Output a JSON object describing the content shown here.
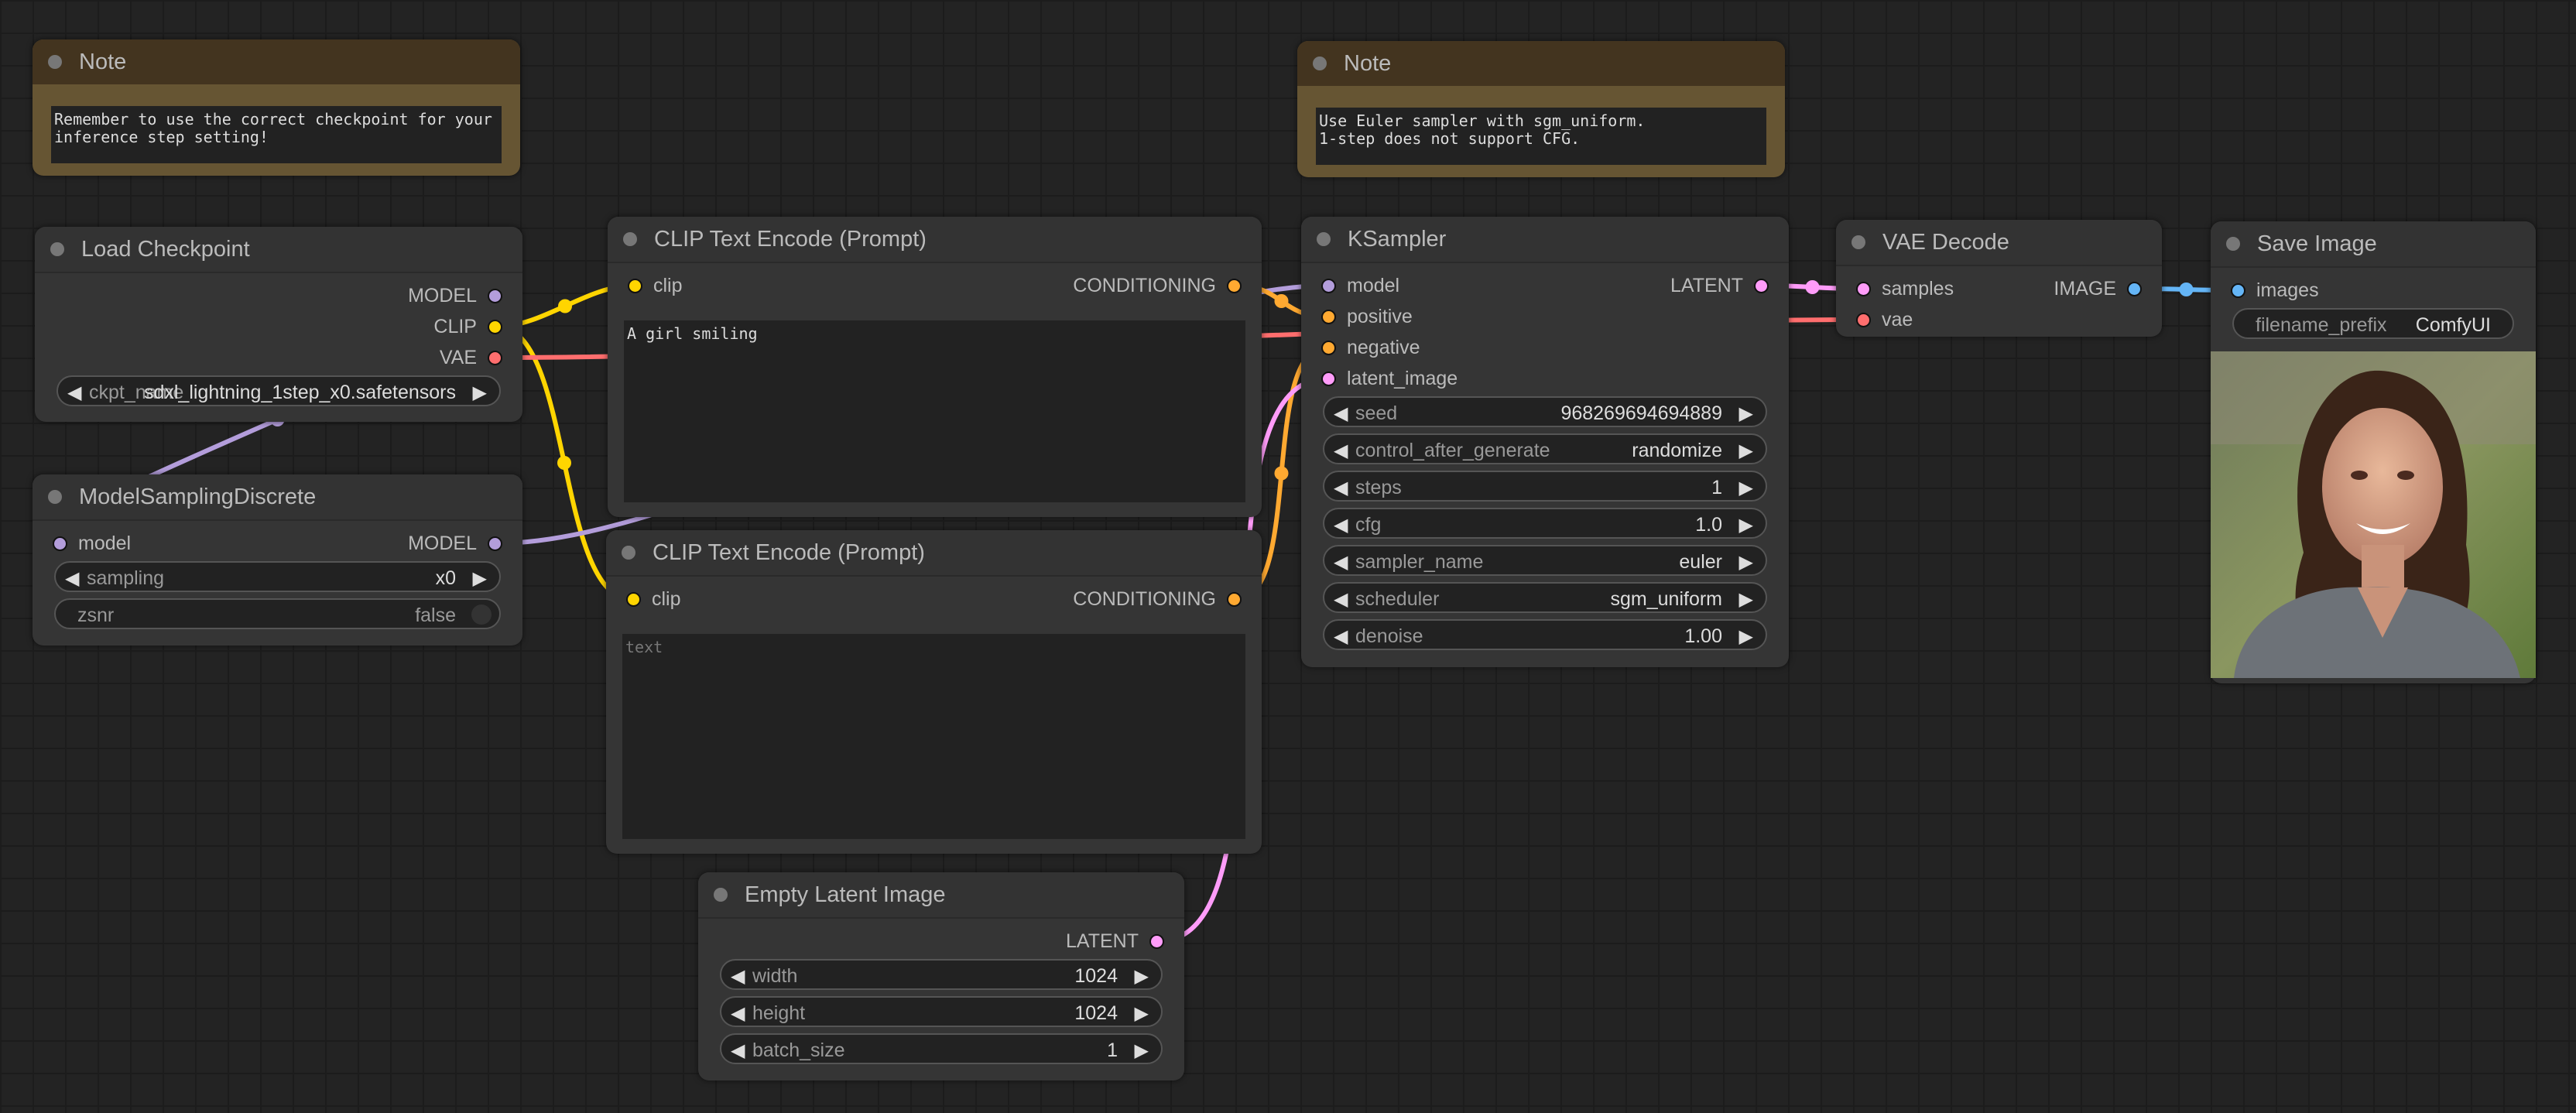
{
  "colors": {
    "MODEL": "#b39ddb",
    "CLIP": "#ffd500",
    "VAE": "#ff6e6e",
    "CONDITIONING": "#ffa931",
    "LATENT": "#ff9cf9",
    "IMAGE": "#64b5f6"
  },
  "nodes": {
    "note1": {
      "title": "Note",
      "text": "Remember to use the correct checkpoint for your\ninference step setting!"
    },
    "note2": {
      "title": "Note",
      "text": "Use Euler sampler with sgm_uniform.\n1-step does not support CFG."
    },
    "load_checkpoint": {
      "title": "Load Checkpoint",
      "inputs": [],
      "outputs": [
        {
          "label": "MODEL",
          "type": "MODEL"
        },
        {
          "label": "CLIP",
          "type": "CLIP"
        },
        {
          "label": "VAE",
          "type": "VAE"
        }
      ],
      "widgets": [
        {
          "kind": "combo",
          "label": "ckpt_name",
          "value": "sdxl_lightning_1step_x0.safetensors"
        }
      ]
    },
    "model_sampling": {
      "title": "ModelSamplingDiscrete",
      "inputs": [
        {
          "label": "model",
          "type": "MODEL"
        }
      ],
      "outputs": [
        {
          "label": "MODEL",
          "type": "MODEL"
        }
      ],
      "widgets": [
        {
          "kind": "combo",
          "label": "sampling",
          "value": "x0"
        },
        {
          "kind": "toggle",
          "label": "zsnr",
          "value": "false"
        }
      ]
    },
    "clip_pos": {
      "title": "CLIP Text Encode (Prompt)",
      "inputs": [
        {
          "label": "clip",
          "type": "CLIP"
        }
      ],
      "outputs": [
        {
          "label": "CONDITIONING",
          "type": "CONDITIONING"
        }
      ],
      "textarea": {
        "value": "A girl smiling",
        "placeholder": "text"
      }
    },
    "clip_neg": {
      "title": "CLIP Text Encode (Prompt)",
      "inputs": [
        {
          "label": "clip",
          "type": "CLIP"
        }
      ],
      "outputs": [
        {
          "label": "CONDITIONING",
          "type": "CONDITIONING"
        }
      ],
      "textarea": {
        "value": "",
        "placeholder": "text"
      }
    },
    "empty_latent": {
      "title": "Empty Latent Image",
      "inputs": [],
      "outputs": [
        {
          "label": "LATENT",
          "type": "LATENT"
        }
      ],
      "widgets": [
        {
          "kind": "number",
          "label": "width",
          "value": "1024"
        },
        {
          "kind": "number",
          "label": "height",
          "value": "1024"
        },
        {
          "kind": "number",
          "label": "batch_size",
          "value": "1"
        }
      ]
    },
    "ksampler": {
      "title": "KSampler",
      "inputs": [
        {
          "label": "model",
          "type": "MODEL"
        },
        {
          "label": "positive",
          "type": "CONDITIONING"
        },
        {
          "label": "negative",
          "type": "CONDITIONING"
        },
        {
          "label": "latent_image",
          "type": "LATENT"
        }
      ],
      "outputs": [
        {
          "label": "LATENT",
          "type": "LATENT"
        }
      ],
      "widgets": [
        {
          "kind": "number",
          "label": "seed",
          "value": "968269694694889"
        },
        {
          "kind": "combo",
          "label": "control_after_generate",
          "value": "randomize"
        },
        {
          "kind": "number",
          "label": "steps",
          "value": "1"
        },
        {
          "kind": "number",
          "label": "cfg",
          "value": "1.0"
        },
        {
          "kind": "combo",
          "label": "sampler_name",
          "value": "euler"
        },
        {
          "kind": "combo",
          "label": "scheduler",
          "value": "sgm_uniform"
        },
        {
          "kind": "number",
          "label": "denoise",
          "value": "1.00"
        }
      ]
    },
    "vae_decode": {
      "title": "VAE Decode",
      "inputs": [
        {
          "label": "samples",
          "type": "LATENT"
        },
        {
          "label": "vae",
          "type": "VAE"
        }
      ],
      "outputs": [
        {
          "label": "IMAGE",
          "type": "IMAGE"
        }
      ]
    },
    "save_image": {
      "title": "Save Image",
      "inputs": [
        {
          "label": "images",
          "type": "IMAGE"
        }
      ],
      "outputs": [],
      "widgets": [
        {
          "kind": "text",
          "label": "filename_prefix",
          "value": "ComfyUI"
        }
      ],
      "preview": "portrait-image"
    }
  }
}
